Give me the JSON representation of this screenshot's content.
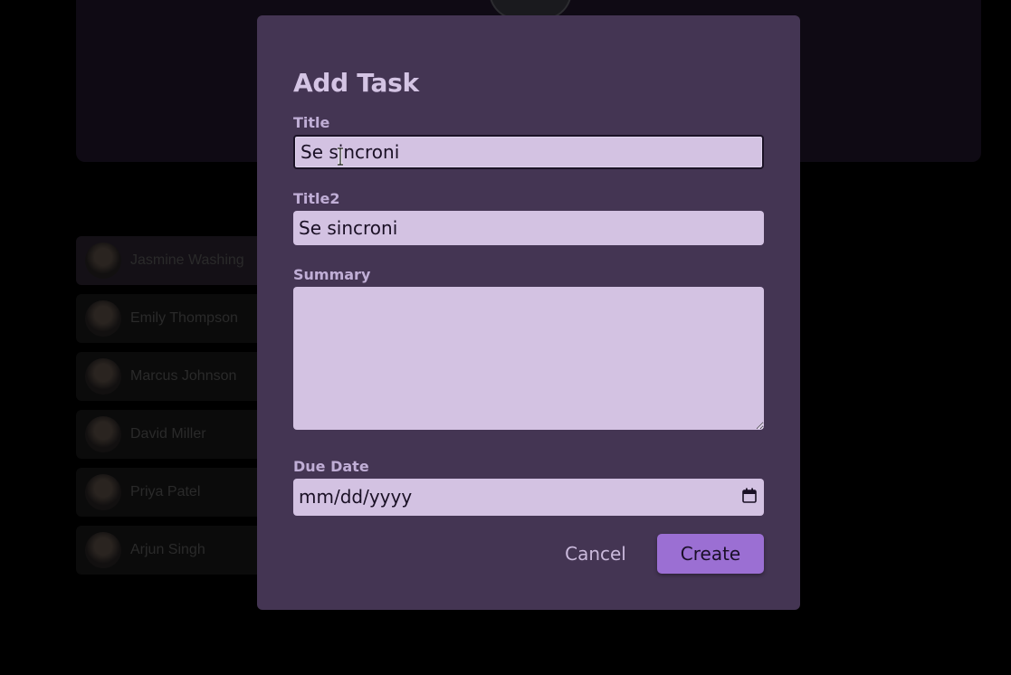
{
  "background": {
    "people": [
      {
        "name": "Jasmine Washing",
        "active": true
      },
      {
        "name": "Emily Thompson"
      },
      {
        "name": "Marcus Johnson"
      },
      {
        "name": "David Miller"
      },
      {
        "name": "Priya Patel"
      },
      {
        "name": "Arjun Singh"
      }
    ]
  },
  "modal": {
    "title": "Add Task",
    "fields": {
      "title": {
        "label": "Title",
        "value": "Se sincroni"
      },
      "title2": {
        "label": "Title2",
        "value": "Se sincroni"
      },
      "summary": {
        "label": "Summary",
        "value": ""
      },
      "due_date": {
        "label": "Due Date",
        "value": "mm/dd/yyyy"
      }
    },
    "buttons": {
      "cancel": "Cancel",
      "create": "Create"
    }
  },
  "colors": {
    "modal_bg": "#443553",
    "field_bg": "#d3c2e2",
    "accent": "#9b6fd3",
    "label": "#c0aed6"
  },
  "icons": {
    "date_picker": "calendar-icon",
    "pointer": "text-cursor-icon"
  }
}
